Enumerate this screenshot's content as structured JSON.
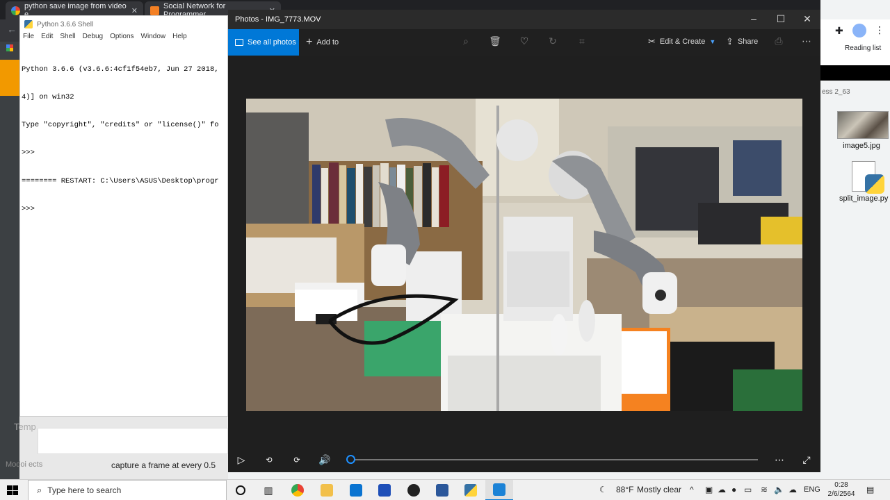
{
  "browser": {
    "tabs": [
      {
        "title": "python save image from video e"
      },
      {
        "title": "Social Network for Programmer"
      }
    ],
    "reading_list_label": "Reading list"
  },
  "desktop": {
    "icons": [
      {
        "label": "image5.jpg"
      },
      {
        "label": "split_image.py"
      }
    ],
    "partial_text": "ess 2_63"
  },
  "shell": {
    "title": "Python 3.6.6 Shell",
    "menu": [
      "File",
      "Edit",
      "Shell",
      "Debug",
      "Options",
      "Window",
      "Help"
    ],
    "lines": [
      "Python 3.6.6 (v3.6.6:4cf1f54eb7, Jun 27 2018,",
      "4)] on win32",
      "Type \"copyright\", \"credits\" or \"license()\" fo",
      ">>> ",
      "======== RESTART: C:\\Users\\ASUS\\Desktop\\progr",
      ">>> "
    ]
  },
  "background_texts": {
    "temp": "Temp",
    "capture": "capture a frame at every 0.5",
    "modoi": "Modoi ects"
  },
  "photos": {
    "window_title": "Photos - IMG_7773.MOV",
    "see_all_label": "See all photos",
    "add_to_label": "Add to",
    "edit_create_label": "Edit & Create",
    "share_label": "Share",
    "progress_fraction": 0.0
  },
  "taskbar": {
    "search_placeholder": "Type here to search",
    "weather_temp": "88°F",
    "weather_desc": "Mostly clear",
    "language": "ENG",
    "time": "0:28",
    "date": "2/6/2564"
  },
  "colors": {
    "accent": "#0078d7",
    "photos_bg": "#1f1f1f",
    "shell_bg": "#ffffff"
  }
}
